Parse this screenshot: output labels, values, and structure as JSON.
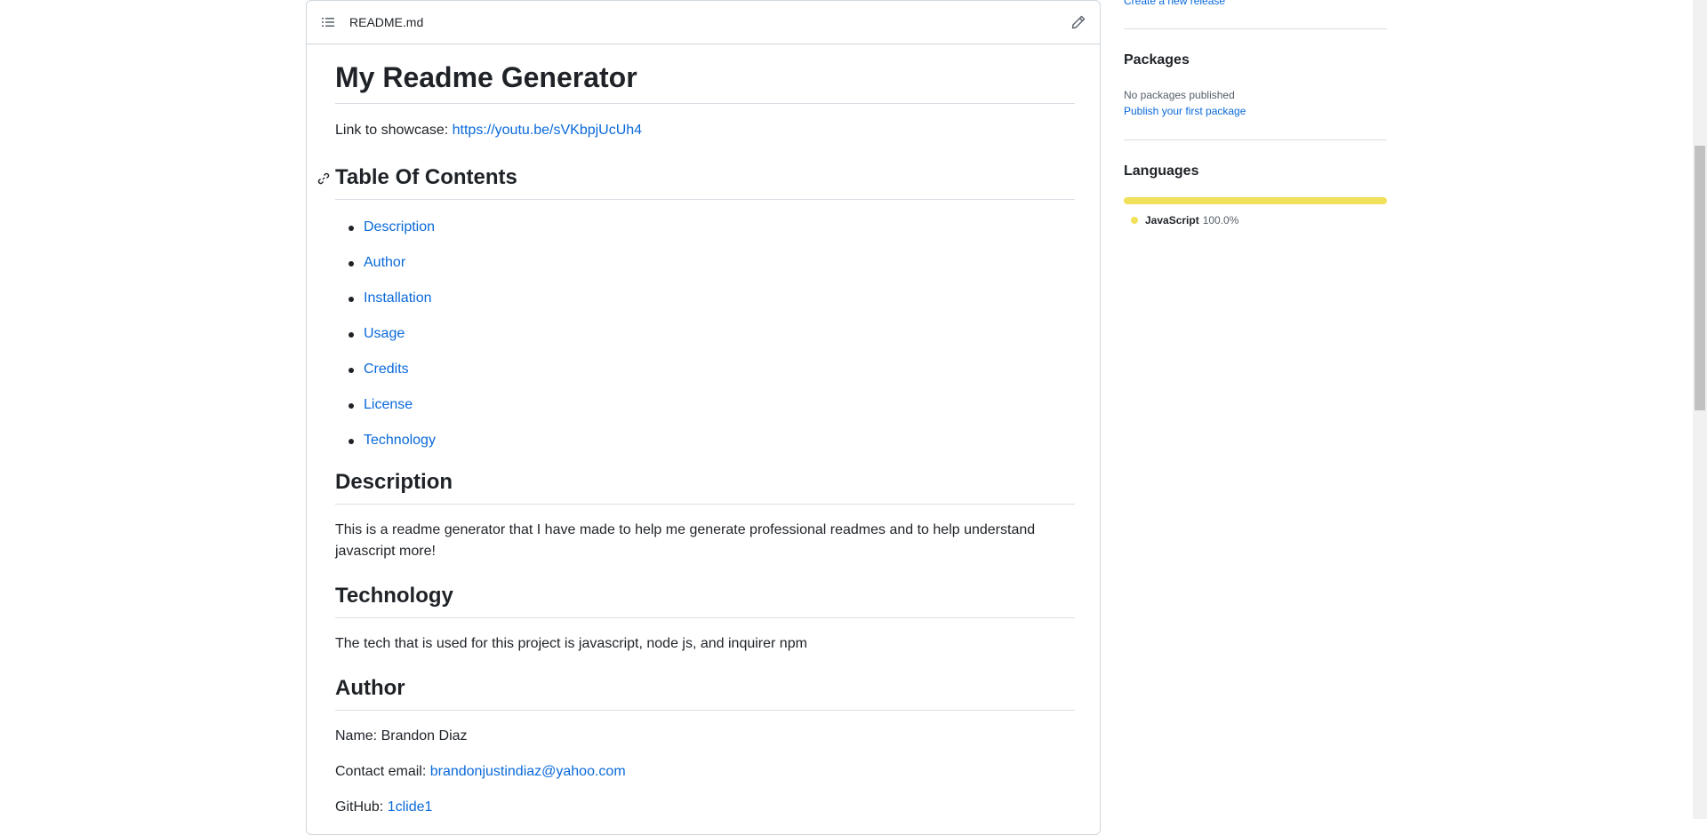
{
  "readme": {
    "filename": "README.md",
    "title": "My Readme Generator",
    "showcase_label": "Link to showcase: ",
    "showcase_link": "https://youtu.be/sVKbpjUcUh4",
    "toc_heading": "Table Of Contents",
    "toc_items": [
      "Description",
      "Author",
      "Installation",
      "Usage",
      "Credits",
      "License",
      "Technology"
    ],
    "description_heading": "Description",
    "description_text": "This is a readme generator that I have made to help me generate professional readmes and to help understand javascript more!",
    "technology_heading": "Technology",
    "technology_text": "The tech that is used for this project is javascript, node js, and inquirer npm",
    "author_heading": "Author",
    "author_name": "Name: Brandon Diaz",
    "contact_label": "Contact email: ",
    "contact_email": "brandonjustindiaz@yahoo.com",
    "github_label": "GitHub: ",
    "github_user": "1clide1"
  },
  "sidebar": {
    "create_release": "Create a new release",
    "packages_heading": "Packages",
    "packages_text": "No packages published",
    "packages_link": "Publish your first package",
    "languages_heading": "Languages",
    "languages": [
      {
        "name": "JavaScript",
        "percent": "100.0%",
        "color": "#f1e05a"
      }
    ]
  },
  "colors": {
    "link": "#0969da",
    "text": "#1f2328",
    "border": "#d0d7de",
    "javascript": "#f1e05a"
  }
}
